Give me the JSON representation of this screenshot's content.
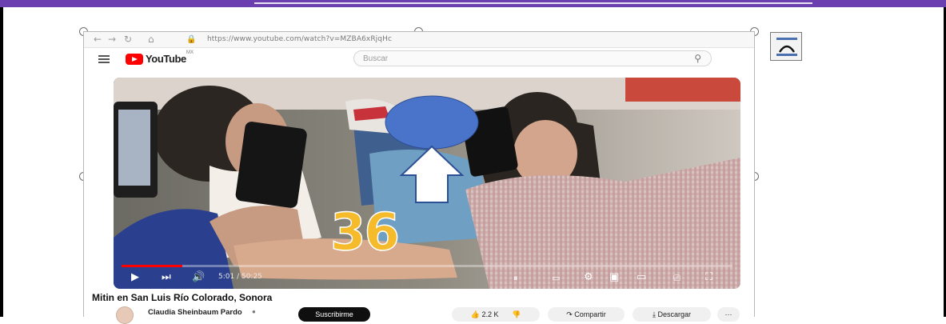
{
  "browser": {
    "url": "https://www.youtube.com/watch?v=MZBA6xRjqHc",
    "back_icon": "back-arrow-icon",
    "forward_icon": "forward-arrow-icon",
    "reload_icon": "reload-icon",
    "home_icon": "home-icon"
  },
  "youtube": {
    "logo_text": "YouTube",
    "region": "MX",
    "search_placeholder": "Buscar"
  },
  "video": {
    "overlay_number": "36",
    "time": "5:01 / 50:25",
    "progress": 0.1,
    "progress_color": "#ff0000"
  },
  "meta": {
    "title": "Mitin en San Luis Río Colorado, Sonora",
    "channel": "Claudia Sheinbaum Pardo",
    "subscribe_label": "Suscribirme",
    "likes": "2.2 K",
    "share_label": "Compartir",
    "download_label": "Descargar",
    "more_label": "···"
  },
  "colors": {
    "top_band": "#6c3fb0",
    "overlay_digits": "#f5bb2a",
    "face_mask": "#4a74c9"
  }
}
